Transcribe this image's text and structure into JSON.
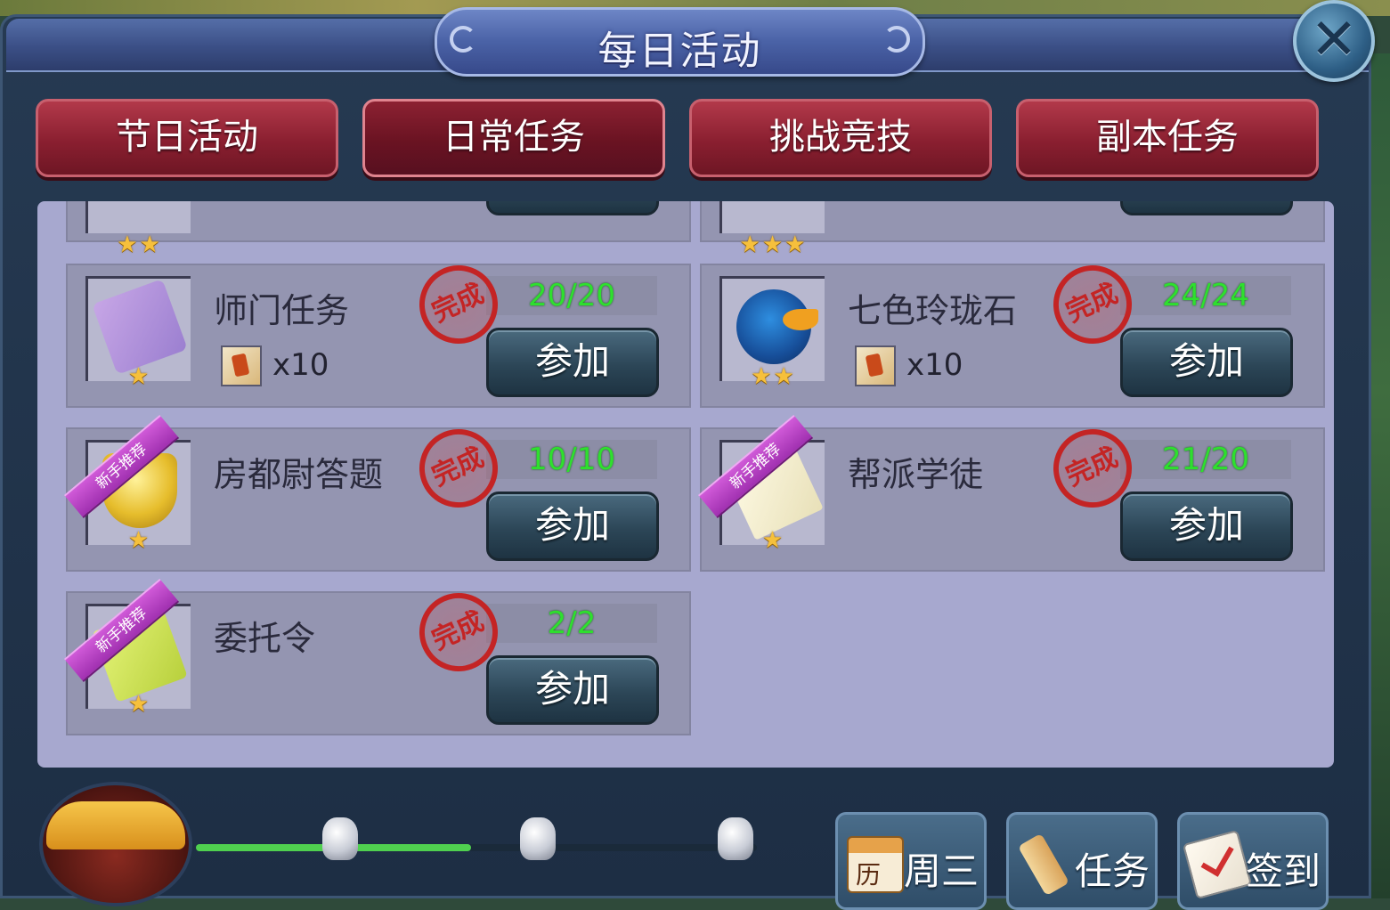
{
  "window": {
    "title": "每日活动",
    "close_label": "✕"
  },
  "tabs": [
    {
      "label": "节日活动",
      "active": false
    },
    {
      "label": "日常任务",
      "active": true
    },
    {
      "label": "挑战竞技",
      "active": false
    },
    {
      "label": "副本任务",
      "active": false
    }
  ],
  "partial_cards": [
    {
      "stars": "★★"
    },
    {
      "stars": "★★★"
    }
  ],
  "activities": [
    {
      "name": "师门任务",
      "stars": "★",
      "reward_qty": "x10",
      "stamp": "完成",
      "progress": "20/20",
      "button": "参加",
      "ribbon": ""
    },
    {
      "name": "七色玲珑石",
      "stars": "★★",
      "reward_qty": "x10",
      "stamp": "完成",
      "progress": "24/24",
      "button": "参加",
      "ribbon": ""
    },
    {
      "name": "房都尉答题",
      "stars": "★",
      "reward_qty": "",
      "stamp": "完成",
      "progress": "10/10",
      "button": "参加",
      "ribbon": "新手推荐"
    },
    {
      "name": "帮派学徒",
      "stars": "★",
      "reward_qty": "",
      "stamp": "完成",
      "progress": "21/20",
      "button": "参加",
      "ribbon": "新手推荐"
    },
    {
      "name": "委托令",
      "stars": "★",
      "reward_qty": "",
      "stamp": "完成",
      "progress": "2/2",
      "button": "参加",
      "ribbon": "新手推荐"
    }
  ],
  "activity_progress": {
    "fraction": 0.49
  },
  "bottom_buttons": [
    {
      "label": "周三",
      "icon": "calendar-icon",
      "icon_text": "历"
    },
    {
      "label": "任务",
      "icon": "scroll-icon"
    },
    {
      "label": "签到",
      "icon": "checkin-icon"
    }
  ],
  "colors": {
    "tab_red": "#8a1f30",
    "content_bg": "#a7a8cf",
    "progress_green": "#2ee02e",
    "stamp_red": "#c42424",
    "button_teal": "#2c4657"
  }
}
